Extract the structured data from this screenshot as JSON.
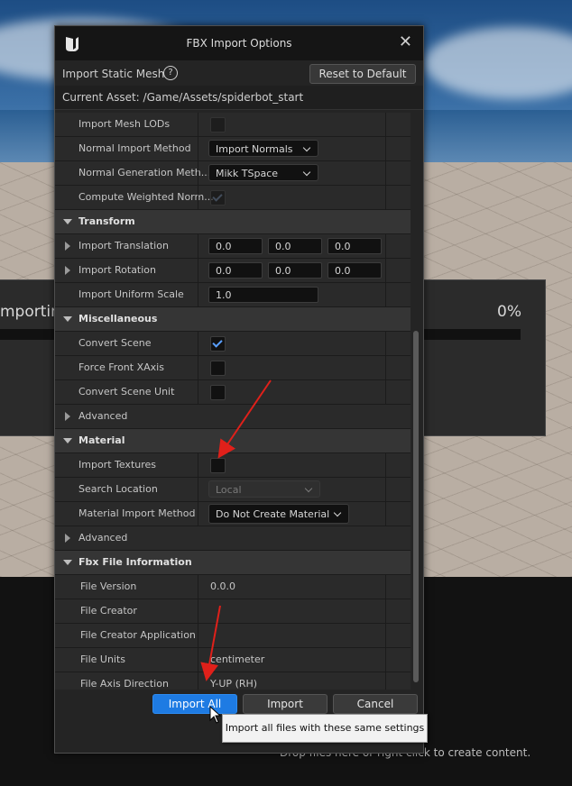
{
  "dialog": {
    "title": "FBX Import Options",
    "header_label": "Import Static Mesh",
    "help_glyph": "?",
    "reset_label": "Reset to Default",
    "current_asset": "Current Asset:  /Game/Assets/spiderbot_start",
    "close_glyph": "✕"
  },
  "progress": {
    "title": "mporting",
    "percent_text": "0%",
    "percent_value": 0
  },
  "rows": {
    "import_mesh_lods": "Import Mesh LODs",
    "normal_import_method": "Normal Import Method",
    "normal_import_value": "Import Normals",
    "normal_generation_method": "Normal Generation Meth...",
    "normal_generation_value": "Mikk TSpace",
    "compute_weighted": "Compute Weighted Norm...",
    "transform": "Transform",
    "import_translation": "Import Translation",
    "translation": [
      "0.0",
      "0.0",
      "0.0"
    ],
    "import_rotation": "Import Rotation",
    "rotation": [
      "0.0",
      "0.0",
      "0.0"
    ],
    "import_uniform_scale": "Import Uniform Scale",
    "uniform_scale": "1.0",
    "miscellaneous": "Miscellaneous",
    "convert_scene": "Convert Scene",
    "force_front_xaxis": "Force Front XAxis",
    "convert_scene_unit": "Convert Scene Unit",
    "advanced_misc": "Advanced",
    "material": "Material",
    "import_textures": "Import Textures",
    "search_location": "Search Location",
    "search_location_value": "Local",
    "material_import_method": "Material Import Method",
    "material_import_value": "Do Not Create Material",
    "advanced_material": "Advanced",
    "fbx_file_information": "Fbx File Information",
    "file_version": "File Version",
    "file_version_value": "0.0.0",
    "file_creator": "File Creator",
    "file_creator_application": "File Creator Application",
    "file_units": "File Units",
    "file_units_value": "centimeter",
    "file_axis_direction": "File Axis Direction",
    "file_axis_direction_value": "Y-UP (RH)"
  },
  "checks": {
    "import_mesh_lods": false,
    "compute_weighted": true,
    "convert_scene": true,
    "force_front_xaxis": false,
    "convert_scene_unit": false,
    "import_textures": false
  },
  "footer": {
    "import_all": "Import All",
    "import": "Import",
    "cancel": "Cancel"
  },
  "tooltip": "Import all files with these same settings",
  "content_browser_hint": "Drop files here or right click to create content.",
  "colors": {
    "accent": "#1e7be3",
    "annotation_arrow": "#e0201a"
  }
}
